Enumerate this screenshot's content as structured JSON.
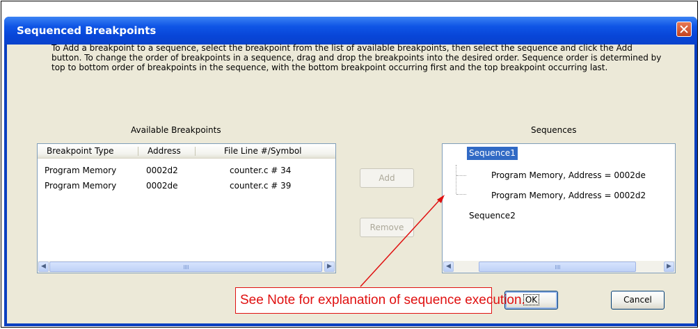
{
  "dialog": {
    "title": "Sequenced Breakpoints",
    "description": "To Add a breakpoint to a sequence, select the breakpoint from the list of available breakpoints, then select the sequence and click the Add button. To change the order of breakpoints in a sequence, drag and drop the breakpoints into the desired order. Sequence order is determined by top to bottom order of breakpoints in the sequence, with the bottom breakpoint occurring first and the top breakpoint occurring last."
  },
  "available": {
    "label": "Available Breakpoints",
    "columns": [
      "Breakpoint Type",
      "Address",
      "File Line #/Symbol"
    ],
    "rows": [
      [
        "Program Memory",
        "0002d2",
        "counter.c # 34"
      ],
      [
        "Program Memory",
        "0002de",
        "counter.c # 39"
      ]
    ]
  },
  "sequences": {
    "label": "Sequences",
    "items": [
      {
        "name": "Sequence1",
        "selected": true,
        "children": [
          "Program Memory, Address = 0002de",
          "Program Memory, Address = 0002d2"
        ]
      },
      {
        "name": "Sequence2",
        "selected": false,
        "children": []
      }
    ]
  },
  "buttons": {
    "add": "Add",
    "remove": "Remove",
    "ok": "OK",
    "cancel": "Cancel"
  },
  "annotation": {
    "note": "See Note for explanation of sequence execution.",
    "color": "#e01010"
  },
  "icons": {
    "close": "close-icon",
    "scroll_left": "chevron-left-icon",
    "scroll_right": "chevron-right-icon"
  },
  "colors": {
    "titlebar": "#0845d8",
    "dialog_bg": "#ece9d8",
    "selection": "#316ac5"
  }
}
